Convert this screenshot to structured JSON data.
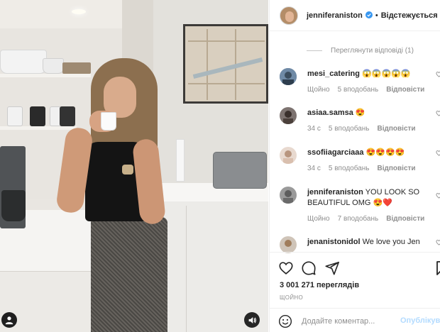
{
  "post": {
    "username": "jenniferaniston",
    "follow_status": "Відстежується",
    "separator": "•",
    "view_replies": "Переглянути відповіді (1)",
    "views": "3 001 271 переглядів",
    "date": "ЩОЙНО"
  },
  "comments": [
    {
      "user": "mesi_catering",
      "text": "😱😱😱😱😱",
      "time": "Щойно",
      "likes": "5 вподобань",
      "reply": "Відповісти"
    },
    {
      "user": "asiaa.samsa",
      "text": "😍",
      "time": "34 с",
      "likes": "5 вподобань",
      "reply": "Відповісти"
    },
    {
      "user": "ssofiiagarciaaa",
      "text": "😍😍😍😍",
      "time": "34 с",
      "likes": "5 вподобань",
      "reply": "Відповісти"
    },
    {
      "user": "jenniferaniston",
      "text": "YOU LOOK SO BEAUTIFUL OMG 😍❤️",
      "time": "Щойно",
      "likes": "7 вподобань",
      "reply": "Відповісти"
    },
    {
      "user": "jenanistonidol",
      "text": "We love you Jen"
    }
  ],
  "composer": {
    "placeholder": "Додайте коментар...",
    "post_label": "Опублікувати"
  },
  "colors": {
    "text": "#262626",
    "muted": "#8e8e8e",
    "verified": "#3897f0",
    "post_disabled": "#b3dbff",
    "heart_red": "#ed4956"
  },
  "icons": [
    "heart-icon",
    "comment-icon",
    "share-icon",
    "bookmark-icon",
    "emoji-icon",
    "sound-icon",
    "user-tag-icon",
    "verified-icon"
  ]
}
